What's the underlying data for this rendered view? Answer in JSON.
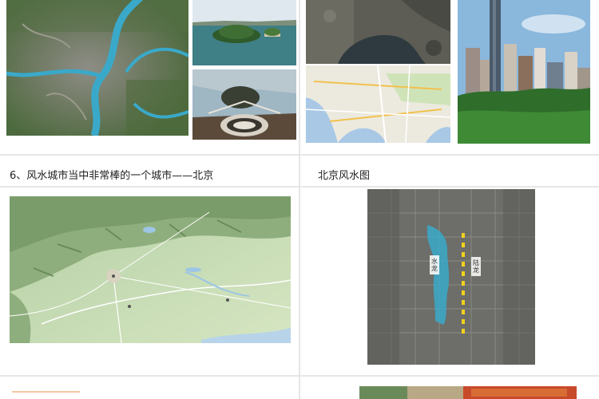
{
  "section_left": {
    "heading": "6、风水城市当中非常棒的一个城市——北京"
  },
  "section_right": {
    "heading": "北京风水图"
  },
  "map_labels": {
    "water_dragon": "水龙",
    "land_dragon": "陆龙"
  },
  "colors": {
    "accent": "#9b1b1b",
    "divider": "#e6e6e6",
    "river": "#3aa9c9"
  }
}
